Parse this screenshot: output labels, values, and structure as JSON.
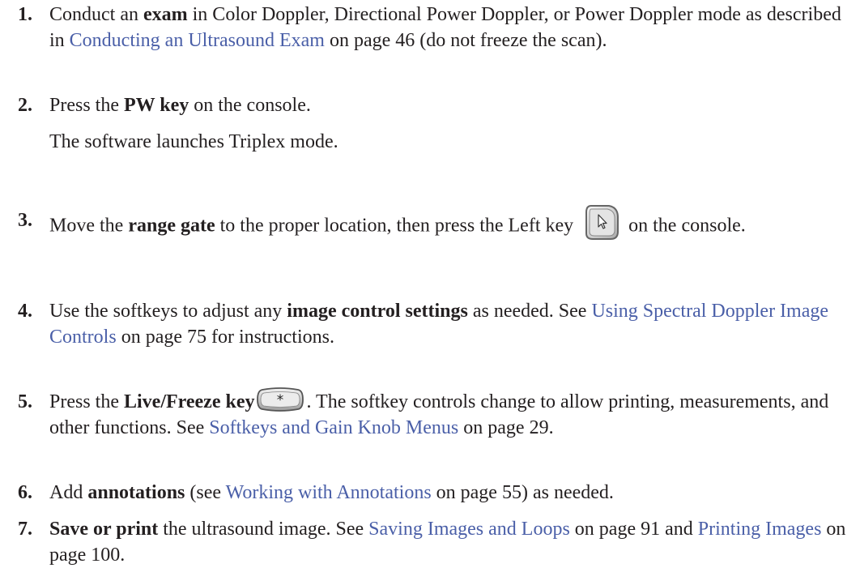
{
  "steps": [
    {
      "num": "1.",
      "pre": "Conduct an ",
      "bold": "exam",
      "mid": " in Color Doppler, Directional Power Doppler, or Power Doppler mode as described in ",
      "link": "Conducting an Ultrasound Exam",
      "post": " on page 46 (do not freeze the scan)."
    },
    {
      "num": "2.",
      "pre": "Press the ",
      "bold": "PW key",
      "post": " on the console.",
      "note": "The software launches Triplex mode."
    },
    {
      "num": "3.",
      "pre": "Move the ",
      "bold": "range gate",
      "mid": " to the proper location, then press the Left key",
      "icon": "pointer-key-icon",
      "post": "on the console."
    },
    {
      "num": "4.",
      "pre": "Use the softkeys to adjust any ",
      "bold": "image control settings",
      "mid": " as needed. See ",
      "link": "Using Spectral Doppler Image Controls",
      "post": " on page 75 for instructions."
    },
    {
      "num": "5.",
      "pre": "Press the ",
      "bold": "Live/Freeze key",
      "icon": "freeze-key-icon",
      "mid": ". The softkey controls change to allow printing, measurements, and other functions. See ",
      "link": "Softkeys and Gain Knob Menus",
      "post": " on page 29."
    },
    {
      "num": "6.",
      "pre": "Add ",
      "bold": "annotations",
      "mid": " (see ",
      "link": "Working with Annotations",
      "post": " on page 55) as needed."
    },
    {
      "num": "7.",
      "bold": "Save or print",
      "mid": " the ultrasound image. See ",
      "link": "Saving Images and Loops",
      "mid2": " on page 91 and ",
      "link2": "Printing Images",
      "post": " on page 100."
    }
  ],
  "colors": {
    "text": "#231f20",
    "link": "#4a5fa8"
  }
}
